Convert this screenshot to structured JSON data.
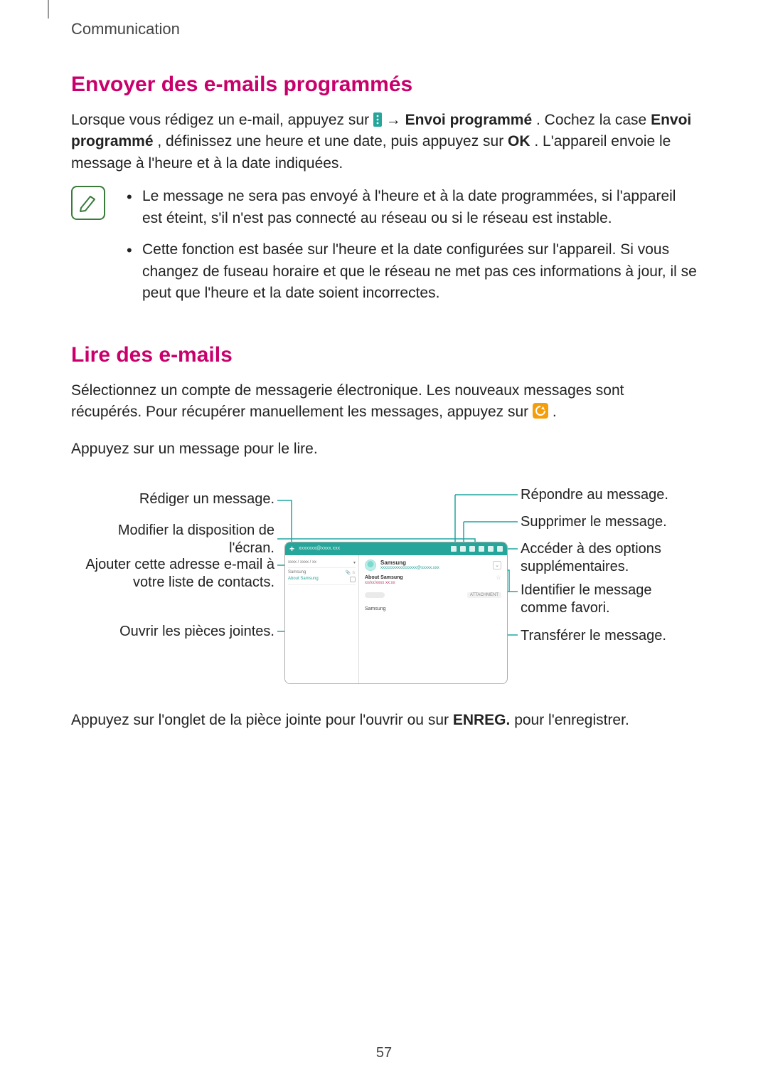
{
  "header": {
    "section": "Communication"
  },
  "h1": "Envoyer des e-mails programmés",
  "para1": {
    "pre": "Lorsque vous rédigez un e-mail, appuyez sur ",
    "arrow": " → ",
    "b1": "Envoi programmé",
    "mid1": ". Cochez la case ",
    "b2": "Envoi programmé",
    "mid2": ", définissez une heure et une date, puis appuyez sur ",
    "b3": "OK",
    "post": ". L'appareil envoie le message à l'heure et à la date indiquées."
  },
  "notes": [
    "Le message ne sera pas envoyé à l'heure et à la date programmées, si l'appareil est éteint, s'il n'est pas connecté au réseau ou si le réseau est instable.",
    "Cette fonction est basée sur l'heure et la date configurées sur l'appareil. Si vous changez de fuseau horaire et que le réseau ne met pas ces informations à jour, il se peut que l'heure et la date soient incorrectes."
  ],
  "h2": "Lire des e-mails",
  "para2": {
    "pre": "Sélectionnez un compte de messagerie électronique. Les nouveaux messages sont récupérés. Pour récupérer manuellement les messages, appuyez sur ",
    "post": "."
  },
  "para3": "Appuyez sur un message pour le lire.",
  "callouts": {
    "left": [
      "Rédiger un message.",
      "Modifier la disposition de l'écran.",
      "Ajouter cette adresse e-mail à votre liste de contacts.",
      "Ouvrir les pièces jointes."
    ],
    "right": [
      "Répondre au message.",
      "Supprimer le message.",
      "Accéder à des options supplémentaires.",
      "Identifier le message comme favori.",
      "Transférer le message."
    ]
  },
  "device": {
    "account": "xxxxxxx@xxxx.xxx",
    "list": {
      "date": "xxxx / xxxx / xx",
      "from": "Samsung",
      "subj": "About Samsung"
    },
    "msg": {
      "from": "Samsung",
      "addr": "xxxxxxxxxxxxxxxxx@xxxxx.xxx",
      "subj": "About Samsung",
      "date": "xx/xx/xxxx xx:xx",
      "attach_tag": "ATTACHMENT",
      "body": "Samsung"
    }
  },
  "para4": {
    "pre": "Appuyez sur l'onglet de la pièce jointe pour l'ouvrir ou sur ",
    "b1": "ENREG.",
    "post": " pour l'enregistrer."
  },
  "page_number": "57"
}
